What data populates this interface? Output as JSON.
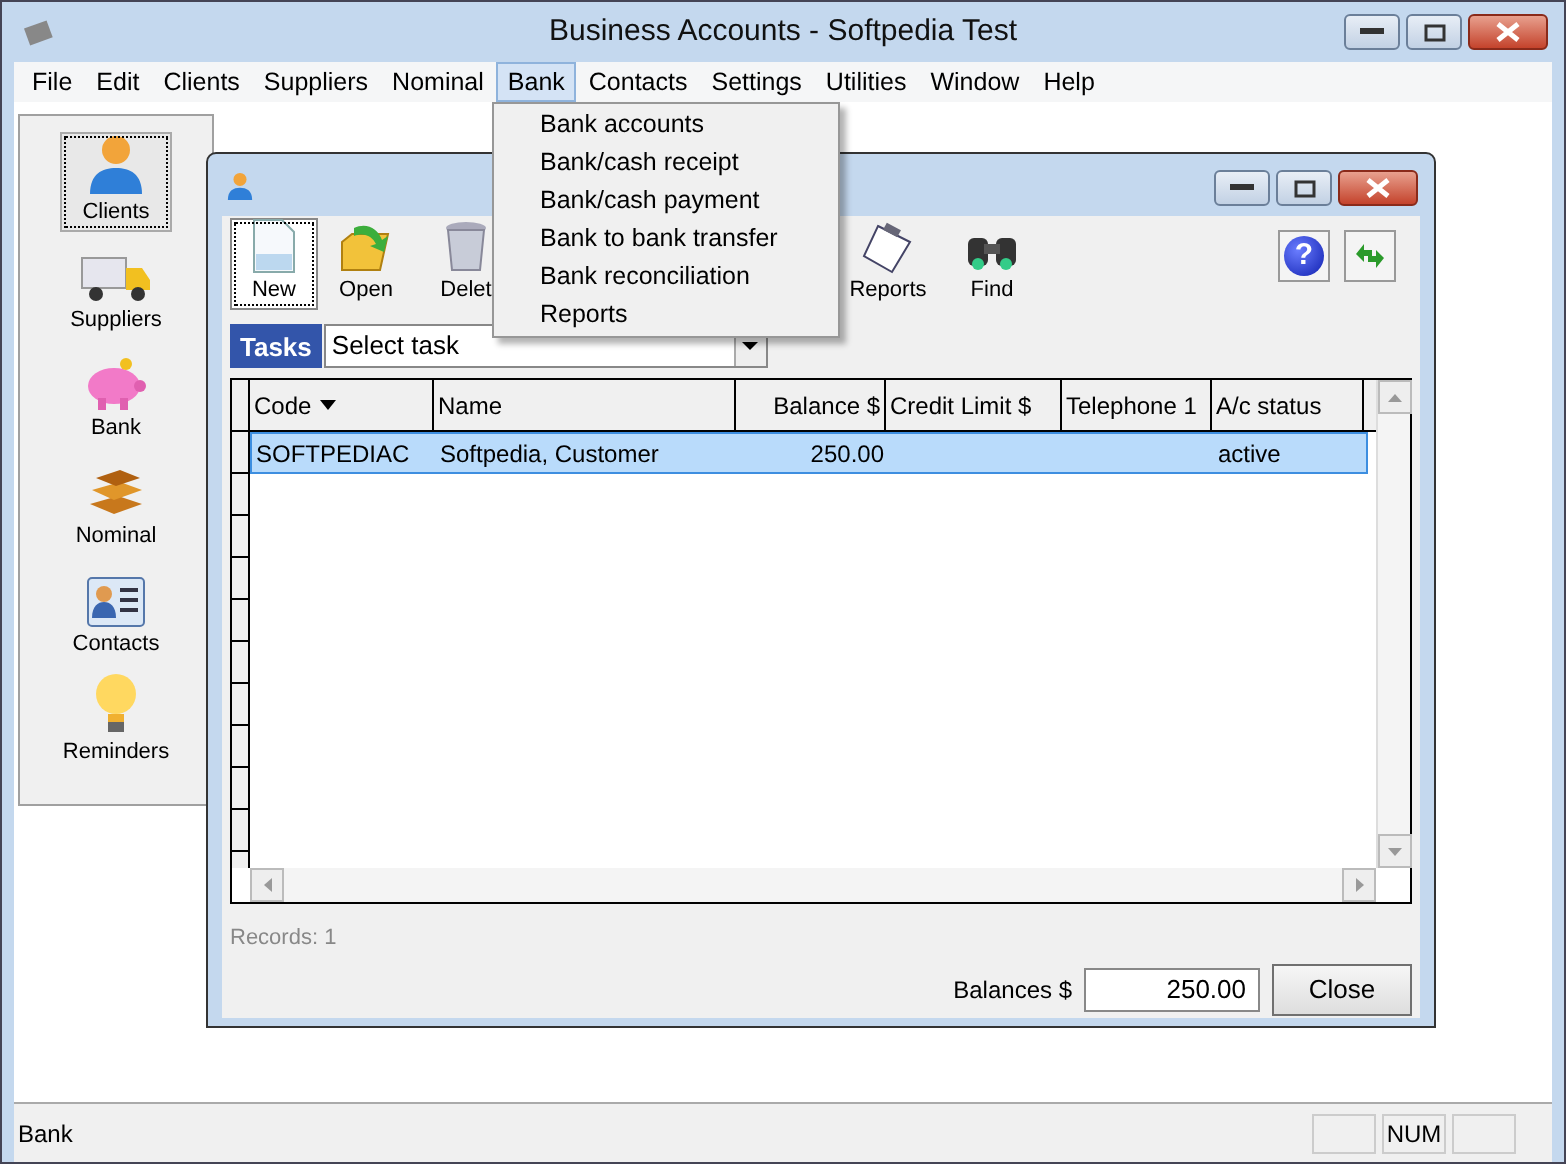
{
  "window": {
    "title": "Business Accounts - Softpedia Test"
  },
  "menu": [
    {
      "label": "File",
      "selected": false
    },
    {
      "label": "Edit",
      "selected": false
    },
    {
      "label": "Clients",
      "selected": false
    },
    {
      "label": "Suppliers",
      "selected": false
    },
    {
      "label": "Nominal",
      "selected": false
    },
    {
      "label": "Bank",
      "selected": true
    },
    {
      "label": "Contacts",
      "selected": false
    },
    {
      "label": "Settings",
      "selected": false
    },
    {
      "label": "Utilities",
      "selected": false
    },
    {
      "label": "Window",
      "selected": false
    },
    {
      "label": "Help",
      "selected": false
    }
  ],
  "dropdown": [
    "Bank accounts",
    "Bank/cash receipt",
    "Bank/cash payment",
    "Bank to bank transfer",
    "Bank reconciliation",
    "Reports"
  ],
  "sidebar": [
    {
      "label": "Clients",
      "selected": true
    },
    {
      "label": "Suppliers",
      "selected": false
    },
    {
      "label": "Bank",
      "selected": false
    },
    {
      "label": "Nominal",
      "selected": false
    },
    {
      "label": "Contacts",
      "selected": false
    },
    {
      "label": "Reminders",
      "selected": false
    }
  ],
  "child": {
    "toolbar": [
      {
        "label": "New",
        "selected": true
      },
      {
        "label": "Open",
        "selected": false
      },
      {
        "label": "Delet",
        "selected": false
      },
      {
        "label": "Reports",
        "selected": false
      },
      {
        "label": "Find",
        "selected": false
      }
    ],
    "help": "?",
    "tasks": {
      "label": "Tasks",
      "value": "Select task"
    },
    "table": {
      "columns": [
        {
          "label": "Code",
          "sorted": true
        },
        {
          "label": "Name",
          "sorted": false
        },
        {
          "label": "Balance $",
          "sorted": false
        },
        {
          "label": "Credit Limit $",
          "sorted": false
        },
        {
          "label": "Telephone 1",
          "sorted": false
        },
        {
          "label": "A/c status",
          "sorted": false
        }
      ],
      "rows": [
        {
          "cells": [
            "SOFTPEDIAC",
            "Softpedia, Customer",
            "250.00",
            "",
            "",
            "active"
          ],
          "selected": true
        }
      ]
    },
    "records": "Records: 1",
    "balances": {
      "label": "Balances $",
      "value": "250.00"
    },
    "close": "Close"
  },
  "status_bar": {
    "text": "Bank",
    "indicators": [
      "NUM"
    ]
  }
}
